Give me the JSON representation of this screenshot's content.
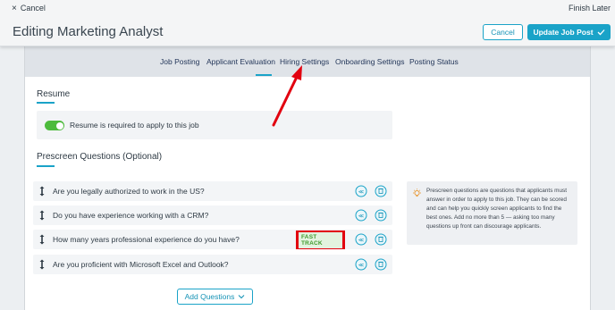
{
  "header": {
    "cancel_label": "Cancel",
    "finish_later_label": "Finish Later",
    "title": "Editing Marketing Analyst",
    "cancel_button": "Cancel",
    "update_button": "Update Job Post"
  },
  "tabs": [
    {
      "label": "Job Posting"
    },
    {
      "label": "Applicant Evaluation"
    },
    {
      "label": "Hiring Settings"
    },
    {
      "label": "Onboarding Settings"
    },
    {
      "label": "Posting Status"
    }
  ],
  "resume": {
    "title": "Resume",
    "toggle_on": true,
    "label": "Resume is required to apply to this job"
  },
  "prescreen": {
    "title": "Prescreen Questions (Optional)",
    "questions": [
      {
        "text": "Are you legally authorized to work in the US?"
      },
      {
        "text": "Do you have experience working with a CRM?"
      },
      {
        "text": "How many years professional experience do you have?",
        "badge": "FAST TRACK"
      },
      {
        "text": "Are you proficient with Microsoft Excel and Outlook?"
      }
    ],
    "add_button": "Add Questions",
    "help_text": "Prescreen questions are questions that applicants must answer in order to apply to this job. They can be scored and can help you quickly screen applicants to find the best ones. Add no more than 5 — asking too many questions up front can discourage applicants."
  },
  "colors": {
    "accent": "#1aa3c8",
    "toggle_on": "#4dbb3c",
    "annotation": "#e2000f",
    "badge_text": "#3f9a2c"
  }
}
